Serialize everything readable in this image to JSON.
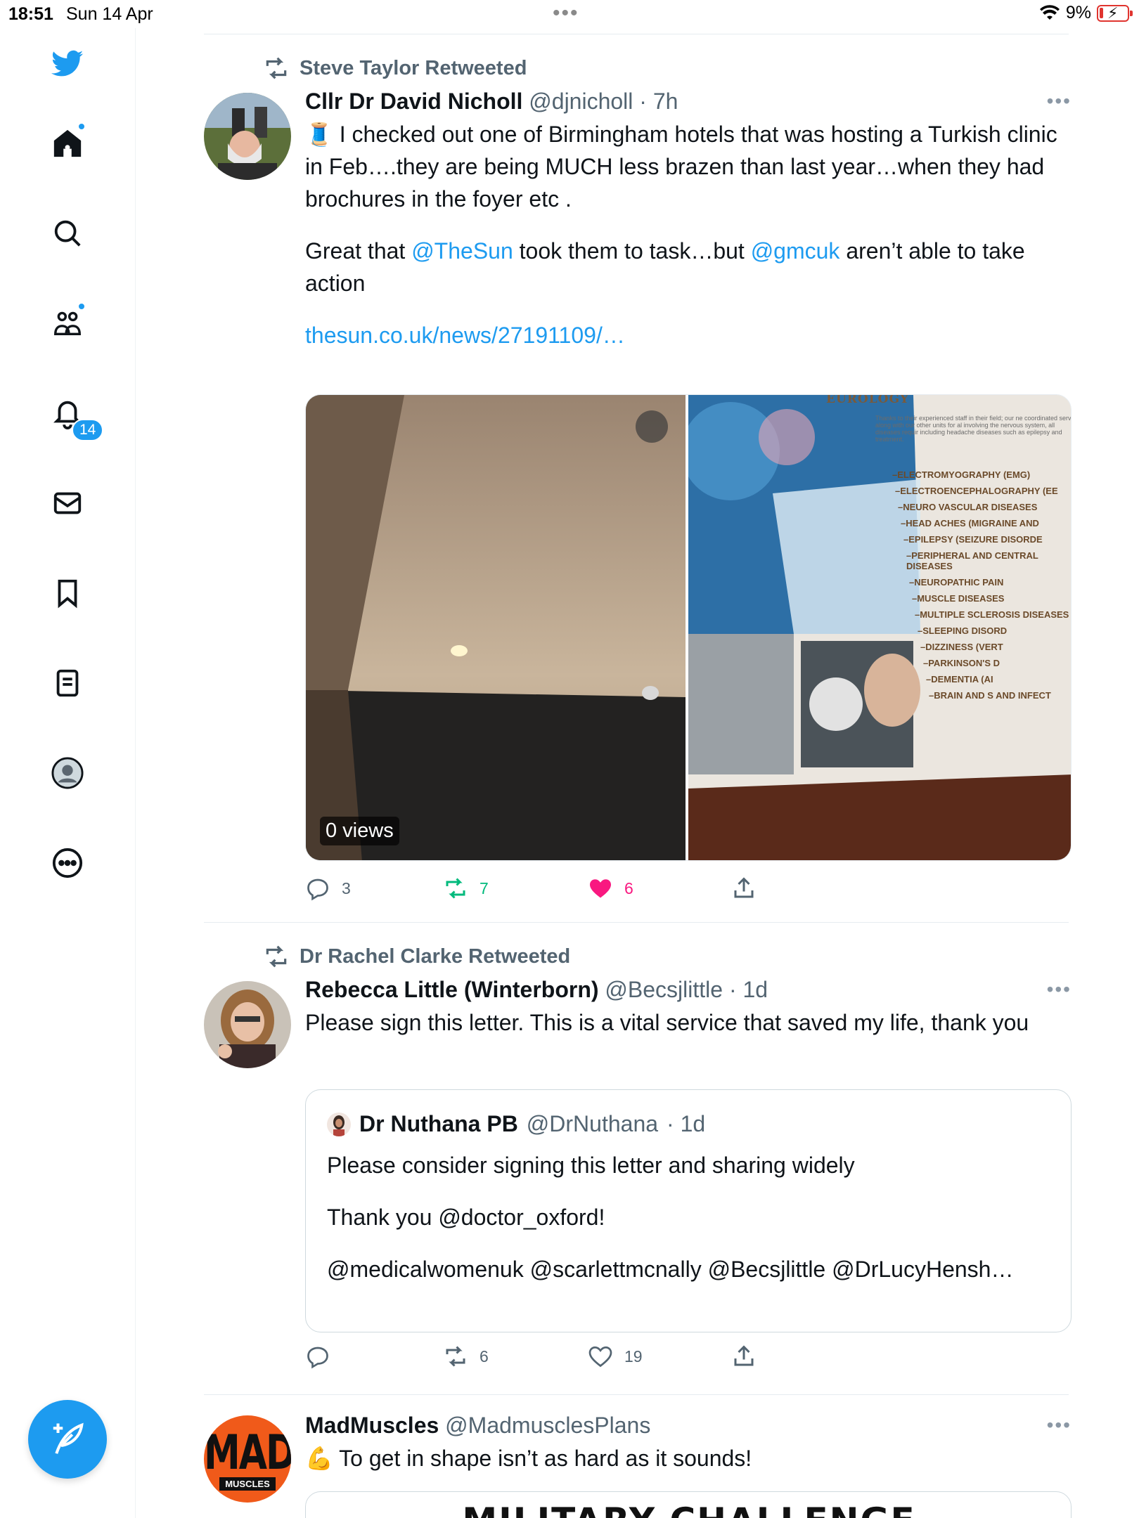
{
  "status_bar": {
    "time": "18:51",
    "date": "Sun 14 Apr",
    "battery": "9%"
  },
  "sidebar": {
    "items": [
      "logo",
      "home",
      "search",
      "communities",
      "notifications",
      "messages",
      "bookmarks",
      "lists",
      "profile",
      "more"
    ],
    "notifications_count": "14"
  },
  "tweets": [
    {
      "retweeted_by": "Steve Taylor Retweeted",
      "name": "Cllr Dr David Nicholl",
      "handle": "@djnicholl",
      "time": "· 7h",
      "text_line1_emoji": "🧵",
      "text_p1": "I checked out one of Birmingham hotels that was hosting a Turkish clinic in Feb….they are being MUCH  less brazen than last year…when they had brochures in the foyer etc .",
      "text_p2_a": "Great that ",
      "text_p2_link1": "@TheSun",
      "text_p2_b": " took them to task…but ",
      "text_p2_link2": "@gmcuk",
      "text_p2_c": " aren’t able to take action",
      "link": "thesun.co.uk/news/27191109/…",
      "video_views": "0 views",
      "brochure": {
        "heading": "EUROLOGY",
        "intro": "Thanks to their experienced staff in their field; our ne coordinated service along with our other units for al involving the nervous system, all diseases requir including headache diseases such as epilepsy and treatment.",
        "items": [
          "ELECTROMYOGRAPHY (EMG)",
          "ELECTROENCEPHALOGRAPHY (EE",
          "NEURO VASCULAR DISEASES",
          "HEAD ACHES (MIGRAINE AND",
          "EPILEPSY (SEIZURE DISORDE",
          "PERIPHERAL AND CENTRAL DISEASES",
          "NEUROPATHIC PAIN",
          "MUSCLE DISEASES",
          "MULTIPLE SCLEROSIS DISEASES",
          "SLEEPING DISORD",
          "DIZZINESS (VERT",
          "PARKINSON'S D",
          "DEMENTIA (AI",
          "BRAIN AND S AND INFECT"
        ]
      },
      "replies": "3",
      "retweets": "7",
      "likes": "6"
    },
    {
      "retweeted_by": "Dr Rachel Clarke Retweeted",
      "name": "Rebecca Little (Winterborn)",
      "handle": "@Becsjlittle",
      "time": "· 1d",
      "text": "Please sign this letter. This is a vital service that saved my life, thank you",
      "quote": {
        "name": "Dr Nuthana PB",
        "handle": "@DrNuthana",
        "time": "· 1d",
        "p1": "Please consider signing this letter and sharing widely",
        "p2": "Thank you @doctor_oxford!",
        "p3": "@medicalwomenuk @scarlettmcnally @Becsjlittle @DrLucyHensh…"
      },
      "replies": "",
      "retweets": "6",
      "likes": "19"
    },
    {
      "name": "MadMuscles",
      "handle": "@MadmusclesPlans",
      "emoji": "💪",
      "text": "To get in shape isn’t as hard as it sounds!",
      "logo_top": "MAD",
      "logo_bottom": "MUSCLES",
      "card_title": "MILITARY CHALLENGE"
    }
  ],
  "colors": {
    "accent": "#1d9bf0",
    "retweet": "#00ba7c",
    "like": "#f91880",
    "muted": "#536471"
  }
}
